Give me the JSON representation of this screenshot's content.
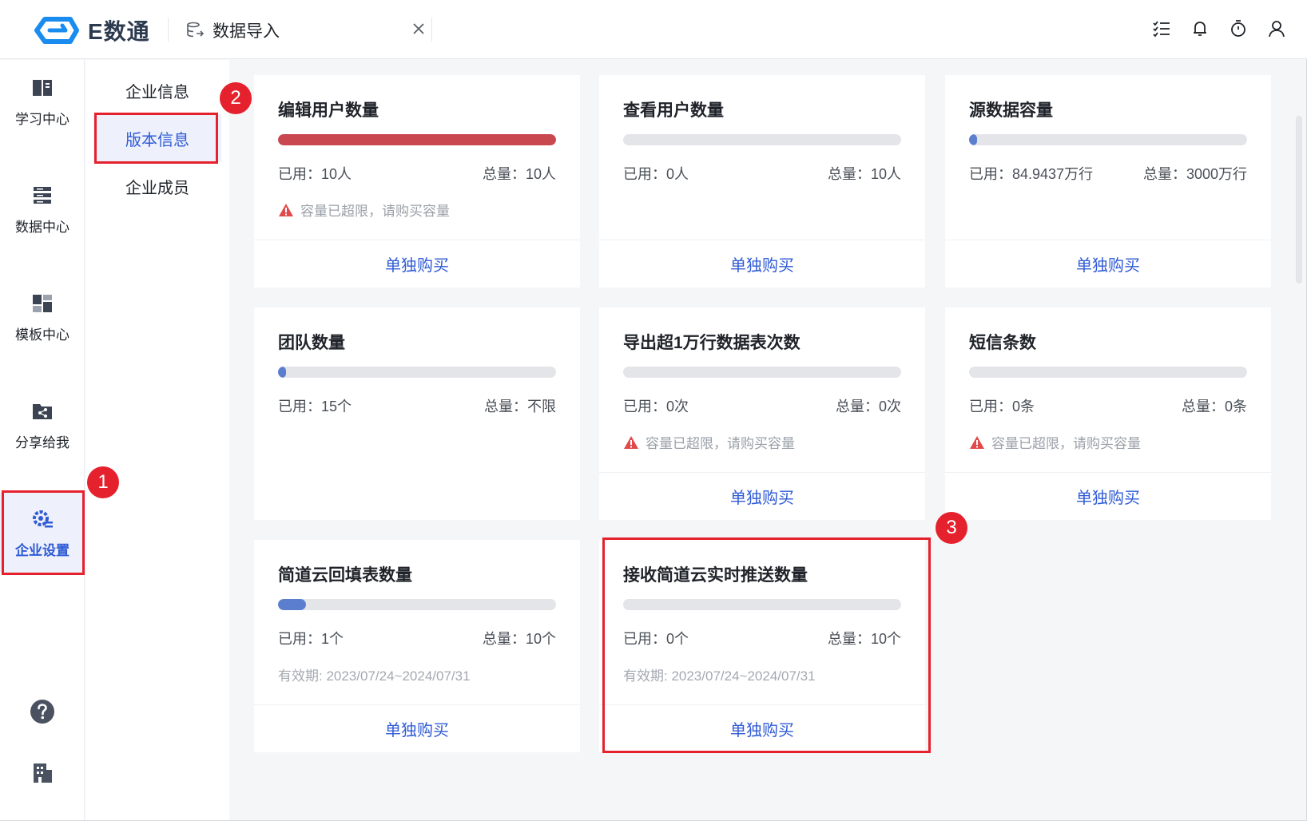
{
  "app": {
    "logo_text": "E数通",
    "tab_label": "数据导入"
  },
  "topbar_icons": [
    "task-list-icon",
    "bell-icon",
    "timer-icon",
    "user-icon"
  ],
  "rail": {
    "items": [
      {
        "label": "学习中心",
        "icon": "book-icon"
      },
      {
        "label": "数据中心",
        "icon": "database-icon"
      },
      {
        "label": "模板中心",
        "icon": "template-icon"
      },
      {
        "label": "分享给我",
        "icon": "share-folder-icon"
      },
      {
        "label": "企业设置",
        "icon": "settings-icon",
        "active": true
      }
    ],
    "bottom_icons": [
      "help-icon",
      "building-icon"
    ]
  },
  "subnav": {
    "items": [
      {
        "label": "企业信息"
      },
      {
        "label": "版本信息",
        "active": true
      },
      {
        "label": "企业成员"
      }
    ]
  },
  "badges": [
    "1",
    "2",
    "3"
  ],
  "cards": [
    {
      "title": "编辑用户数量",
      "used": "已用：10人",
      "total": "总量：10人",
      "fill": 1.0,
      "fill_color": "#c9474e",
      "warning": "容量已超限，请购买容量",
      "validity": "",
      "buy": "单独购买"
    },
    {
      "title": "查看用户数量",
      "used": "已用：0人",
      "total": "总量：10人",
      "fill": 0,
      "fill_color": "#5b7fce",
      "warning": "",
      "validity": "",
      "buy": "单独购买"
    },
    {
      "title": "源数据容量",
      "used": "已用：84.9437万行",
      "total": "总量：3000万行",
      "fill": 0.028,
      "fill_color": "#5b7fce",
      "warning": "",
      "validity": "",
      "buy": "单独购买"
    },
    {
      "title": "团队数量",
      "used": "已用：15个",
      "total": "总量：不限",
      "fill": 0.01,
      "fill_color": "#5b7fce",
      "warning": "",
      "validity": "",
      "buy": ""
    },
    {
      "title": "导出超1万行数据表次数",
      "used": "已用：0次",
      "total": "总量：0次",
      "fill": 0,
      "fill_color": "#5b7fce",
      "warning": "容量已超限，请购买容量",
      "validity": "",
      "buy": "单独购买"
    },
    {
      "title": "短信条数",
      "used": "已用：0条",
      "total": "总量：0条",
      "fill": 0,
      "fill_color": "#5b7fce",
      "warning": "容量已超限，请购买容量",
      "validity": "",
      "buy": "单独购买"
    },
    {
      "title": "简道云回填表数量",
      "used": "已用：1个",
      "total": "总量：10个",
      "fill": 0.1,
      "fill_color": "#5b7fce",
      "warning": "",
      "validity": "有效期: 2023/07/24~2024/07/31",
      "buy": "单独购买"
    },
    {
      "title": "接收简道云实时推送数量",
      "used": "已用：0个",
      "total": "总量：10个",
      "fill": 0,
      "fill_color": "#5b7fce",
      "warning": "",
      "validity": "有效期: 2023/07/24~2024/07/31",
      "buy": "单独购买"
    }
  ]
}
